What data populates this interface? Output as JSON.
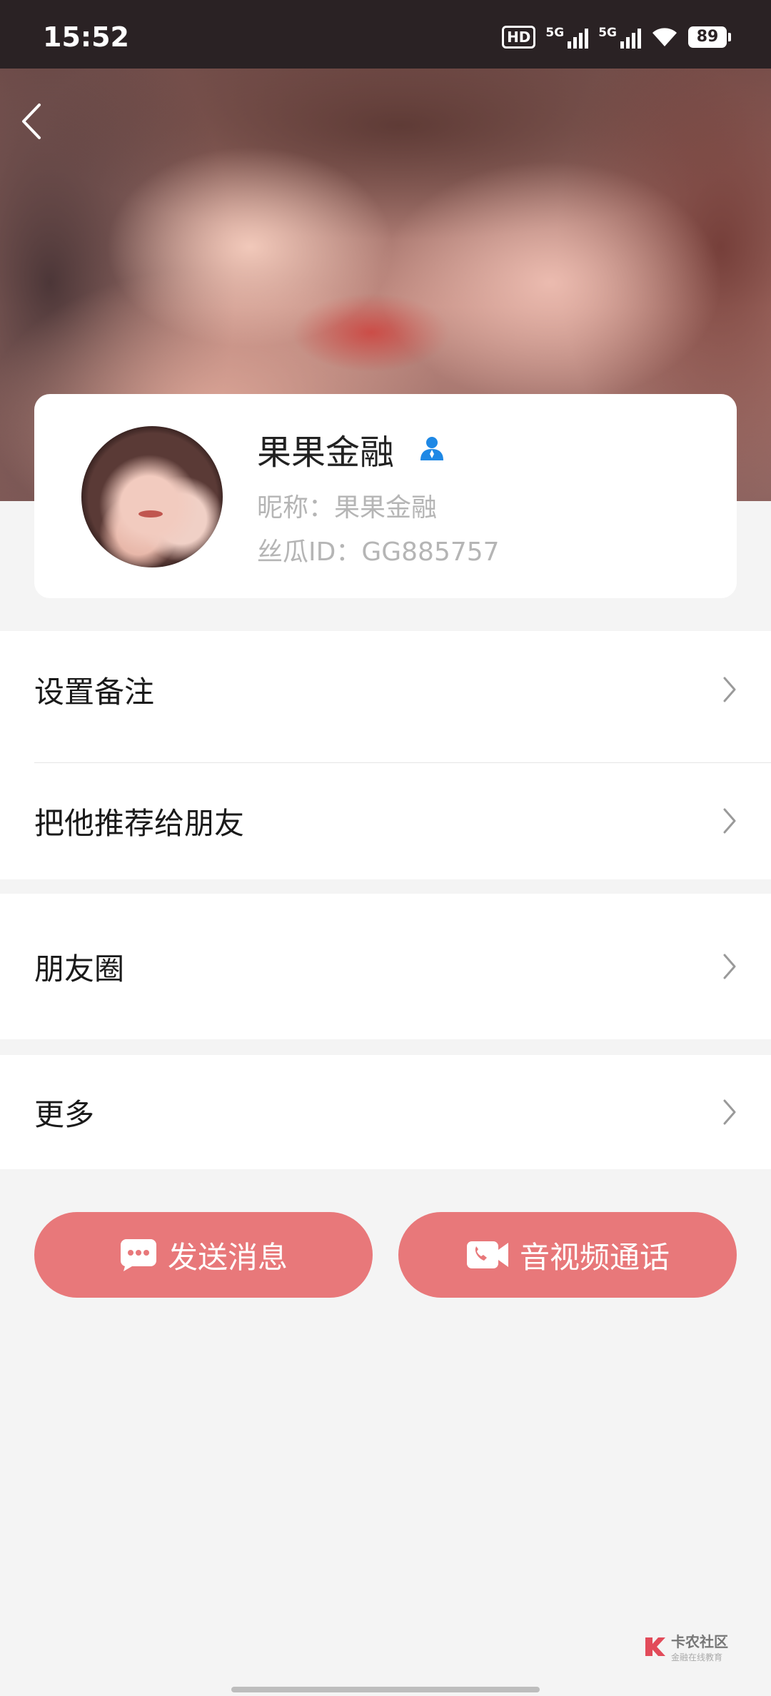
{
  "status_bar": {
    "time": "15:52",
    "hd_label": "HD",
    "network_1": "5G",
    "network_2": "5G",
    "battery": "89"
  },
  "profile": {
    "name": "果果金融",
    "nickname": "昵称：果果金融",
    "id_text": "丝瓜ID：GG885757"
  },
  "menu": {
    "set_remark": "设置备注",
    "recommend": "把他推荐给朋友",
    "moments": "朋友圈",
    "more": "更多"
  },
  "actions": {
    "send_message": "发送消息",
    "av_call": "音视频通话"
  },
  "watermark": {
    "title": "卡农社区",
    "subtitle": "金融在线教育"
  },
  "colors": {
    "accent_button": "#e8787a",
    "verified_icon": "#1e88e5"
  }
}
